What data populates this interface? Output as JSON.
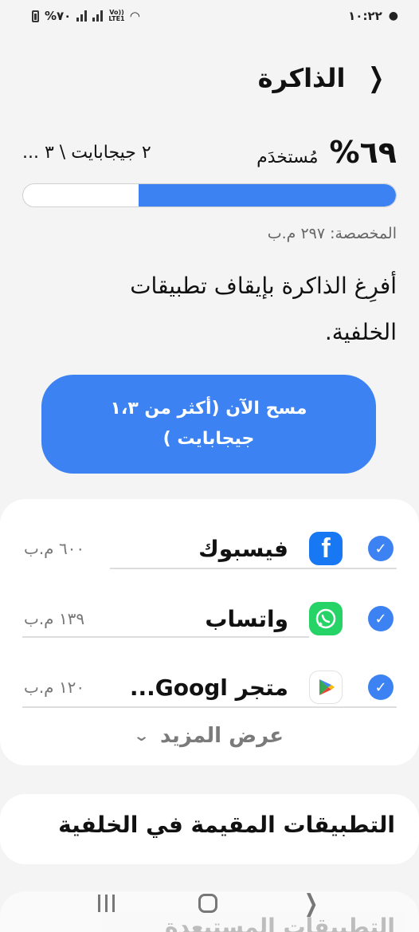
{
  "status_bar": {
    "time": "١٠:٢٢",
    "battery": "%٧٠",
    "network": "LTE1",
    "carrier": "Vo))"
  },
  "header": {
    "title": "الذاكرة"
  },
  "usage": {
    "percent": "٦٩%",
    "label": "مُستخدَم",
    "total": "٢ جيجابايت \\ ٣ ...",
    "fill_fraction": 0.69
  },
  "reserved": "المخصصة: ٢٩٧ م.ب",
  "description": "أفرِغ الذاكرة بإيقاف تطبيقات الخلفية.",
  "clear_button": "مسح الآن (أكثر من ١،٣ جيجابايت )",
  "apps": [
    {
      "name": "فيسبوك",
      "size": "٦٠٠ م.ب",
      "checked": true,
      "icon": "facebook-icon"
    },
    {
      "name": "واتساب",
      "size": "١٣٩ م.ب",
      "checked": true,
      "icon": "whatsapp-icon"
    },
    {
      "name": "متجر Googl...",
      "size": "١٢٠ م.ب",
      "checked": true,
      "icon": "google-play-icon"
    }
  ],
  "see_more": "عرض المزيد",
  "background_apps_title": "التطبيقات المقيمة في الخلفية",
  "bottom_partial": "التطبيقات المستبعدة",
  "colors": {
    "accent": "#3c82f2",
    "background": "#f4f4f4",
    "card": "#ffffff"
  }
}
